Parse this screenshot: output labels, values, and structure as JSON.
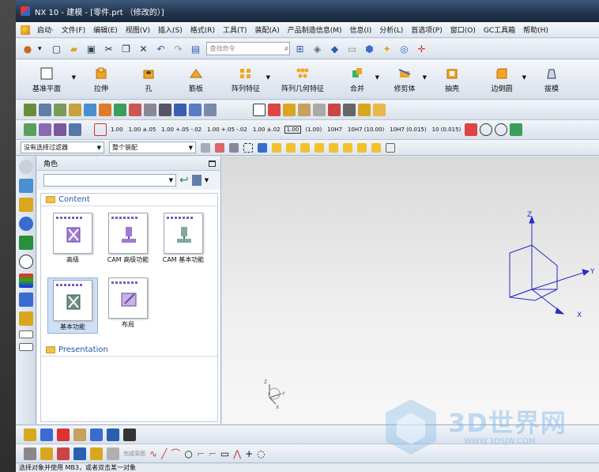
{
  "window": {
    "title": "NX 10 - 建模 - [零件.prt （修改的）]"
  },
  "menu": {
    "start": "启动·",
    "items": [
      "文件(F)",
      "编辑(E)",
      "视图(V)",
      "插入(S)",
      "格式(R)",
      "工具(T)",
      "装配(A)",
      "产品制造信息(M)",
      "信息(I)",
      "分析(L)",
      "首选项(P)",
      "窗口(O)",
      "GC工具箱",
      "帮助(H)"
    ]
  },
  "toolbar": {
    "search_placeholder": "查找命令"
  },
  "features": [
    "基准平面",
    "拉伸",
    "孔",
    "筋板",
    "阵列特征",
    "阵列几何特征",
    "合并",
    "修剪体",
    "抽壳",
    "边倒圆",
    "拔模"
  ],
  "dimension_tags": [
    "1.00",
    "1.00 ±.05",
    "1.00 +.05 -.02",
    "1.00 +.05 -.02",
    "1.00 ±.02",
    "1.00",
    "(1.00)",
    "10H7",
    "10H7 (10.00)",
    "10H7 (0.015)",
    "10 (0.015)"
  ],
  "filter": {
    "selection_filter": "没有选择过滤器",
    "assembly_scope": "整个装配"
  },
  "roles_panel": {
    "title": "角色",
    "groups": [
      {
        "name": "Content",
        "tiles": [
          {
            "label": "高级"
          },
          {
            "label": "CAM 高级功能"
          },
          {
            "label": "CAM 基本功能"
          },
          {
            "label": "基本功能"
          },
          {
            "label": "布局"
          }
        ]
      },
      {
        "name": "Presentation"
      }
    ]
  },
  "viewport": {
    "axes": {
      "x": "X",
      "y": "Y",
      "z": "Z"
    },
    "triad": {
      "x": "X",
      "y": "Y",
      "z": "Z"
    }
  },
  "bottom_toolbar": {
    "finish_sketch": "完成草图"
  },
  "status": {
    "message": "选择对象并使用 MB3，或者双击某一对象"
  },
  "watermark": {
    "text": "3D世界网",
    "url": "WWW.3DSJW.COM"
  },
  "colors": {
    "titlebar": "#22344c",
    "link_blue": "#2457a4",
    "axes_blue": "#2a2ac8",
    "watermark": "#78b4e6"
  }
}
